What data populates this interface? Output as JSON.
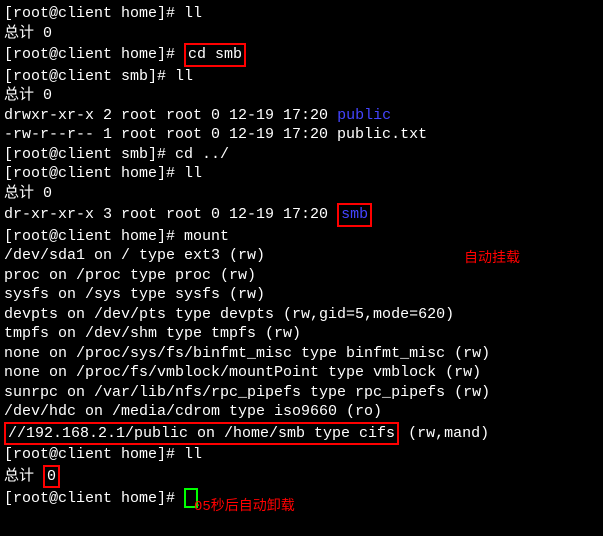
{
  "lines": {
    "l0": {
      "prompt": "[root@client home]# ",
      "cmd": "ll"
    },
    "l1": {
      "text": "总计 0"
    },
    "l2": {
      "prompt": "[root@client home]# ",
      "cmd_boxed": "cd smb"
    },
    "l3": {
      "prompt": "[root@client smb]# ",
      "cmd": "ll"
    },
    "l4": {
      "text": "总计 0"
    },
    "l5": {
      "perms": "drwxr-xr-x 2 root root 0 12-19 17:20 ",
      "name": "public"
    },
    "l6": {
      "text": "-rw-r--r-- 1 root root 0 12-19 17:20 public.txt"
    },
    "l7": {
      "prompt": "[root@client smb]# ",
      "cmd": "cd ../"
    },
    "l8": {
      "prompt": "[root@client home]# ",
      "cmd": "ll"
    },
    "l9": {
      "text": "总计 0"
    },
    "l10": {
      "perms": "dr-xr-xr-x 3 root root 0 12-19 17:20 ",
      "name": "smb"
    },
    "l11": {
      "prompt": "[root@client home]# ",
      "cmd": "mount"
    },
    "l12": {
      "text": "/dev/sda1 on / type ext3 (rw)"
    },
    "l13": {
      "text": "proc on /proc type proc (rw)"
    },
    "l14": {
      "text": "sysfs on /sys type sysfs (rw)"
    },
    "l15": {
      "text": "devpts on /dev/pts type devpts (rw,gid=5,mode=620)"
    },
    "l16": {
      "text": "tmpfs on /dev/shm type tmpfs (rw)"
    },
    "l17": {
      "text": "none on /proc/sys/fs/binfmt_misc type binfmt_misc (rw)"
    },
    "l18": {
      "text": "none on /proc/fs/vmblock/mountPoint type vmblock (rw)"
    },
    "l19": {
      "text": "sunrpc on /var/lib/nfs/rpc_pipefs type rpc_pipefs (rw)"
    },
    "l20": {
      "text": "/dev/hdc on /media/cdrom type iso9660 (ro)"
    },
    "l21": {
      "boxed": "//192.168.2.1/public on /home/smb type cifs",
      "rest": " (rw,mand)"
    },
    "l22": {
      "prompt": "[root@client home]# ",
      "cmd": "ll"
    },
    "l23": {
      "pre": "总计 ",
      "boxed": "0"
    },
    "l24": {
      "prompt": "[root@client home]# "
    }
  },
  "annotations": {
    "a1": "自动挂载",
    "a2": "05秒后自动卸载"
  }
}
